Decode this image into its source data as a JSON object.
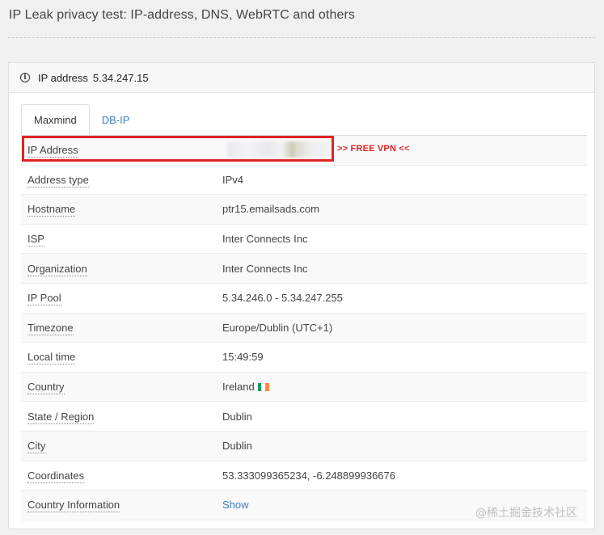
{
  "page": {
    "title": "IP Leak privacy test: IP-address, DNS, WebRTC and others"
  },
  "card": {
    "header_label": "IP address",
    "header_ip": "5.34.247.15",
    "icon": "info-icon"
  },
  "tabs": [
    {
      "label": "Maxmind",
      "active": true
    },
    {
      "label": "DB-IP",
      "active": false
    }
  ],
  "rows": [
    {
      "label": "IP Address",
      "value": ""
    },
    {
      "label": "Address type",
      "value": "IPv4"
    },
    {
      "label": "Hostname",
      "value": "ptr15.emailsads.com"
    },
    {
      "label": "ISP",
      "value": "Inter Connects Inc"
    },
    {
      "label": "Organization",
      "value": "Inter Connects Inc"
    },
    {
      "label": "IP Pool",
      "value": "5.34.246.0 - 5.34.247.255"
    },
    {
      "label": "Timezone",
      "value": "Europe/Dublin (UTC+1)"
    },
    {
      "label": "Local time",
      "value": "15:49:59"
    },
    {
      "label": "Country",
      "value": "Ireland"
    },
    {
      "label": "State / Region",
      "value": "Dublin"
    },
    {
      "label": "City",
      "value": "Dublin"
    },
    {
      "label": "Coordinates",
      "value": "53.333099365234, -6.248899936676"
    },
    {
      "label": "Country Information",
      "value": "Show"
    }
  ],
  "annotation": {
    "text": ">> FREE VPN <<",
    "color": "#e02424"
  },
  "flag": {
    "icon": "ireland-flag-icon",
    "colors": [
      "#169b62",
      "#ffffff",
      "#ff883e"
    ]
  },
  "colors": {
    "link": "#3d7fc1",
    "highlight": "#e02424"
  },
  "watermark": "@稀土掘金技术社区"
}
